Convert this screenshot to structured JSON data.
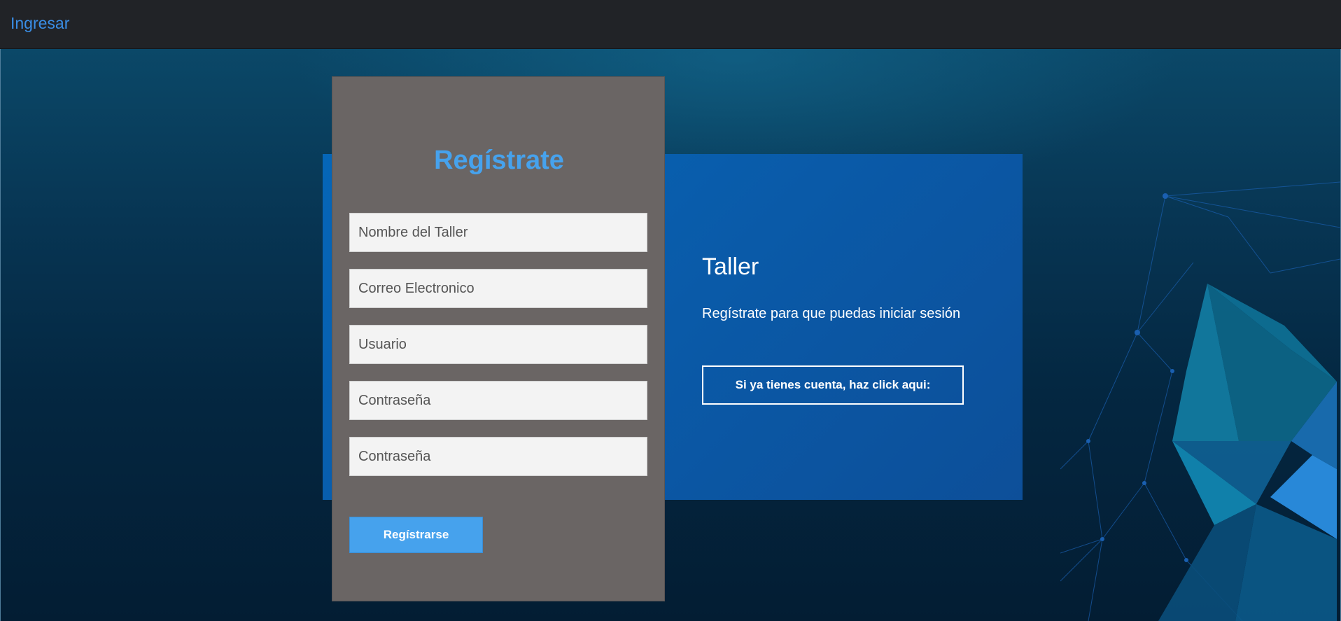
{
  "navbar": {
    "link_label": "Ingresar"
  },
  "register_form": {
    "title": "Regístrate",
    "fields": [
      {
        "placeholder": "Nombre del Taller"
      },
      {
        "placeholder": "Correo Electronico"
      },
      {
        "placeholder": "Usuario"
      },
      {
        "placeholder": "Contraseña"
      },
      {
        "placeholder": "Contraseña"
      }
    ],
    "submit_label": "Regístrarse"
  },
  "info_panel": {
    "title": "Taller",
    "subtitle": "Regístrate para que puedas iniciar sesión",
    "login_button_label": "Si ya tienes cuenta, haz click aqui:"
  },
  "colors": {
    "navbar_bg": "#212327",
    "link": "#3a8ee6",
    "form_bg": "#6a6564",
    "accent": "#46a2ed",
    "info_panel_bg": "#0a5aa8"
  }
}
